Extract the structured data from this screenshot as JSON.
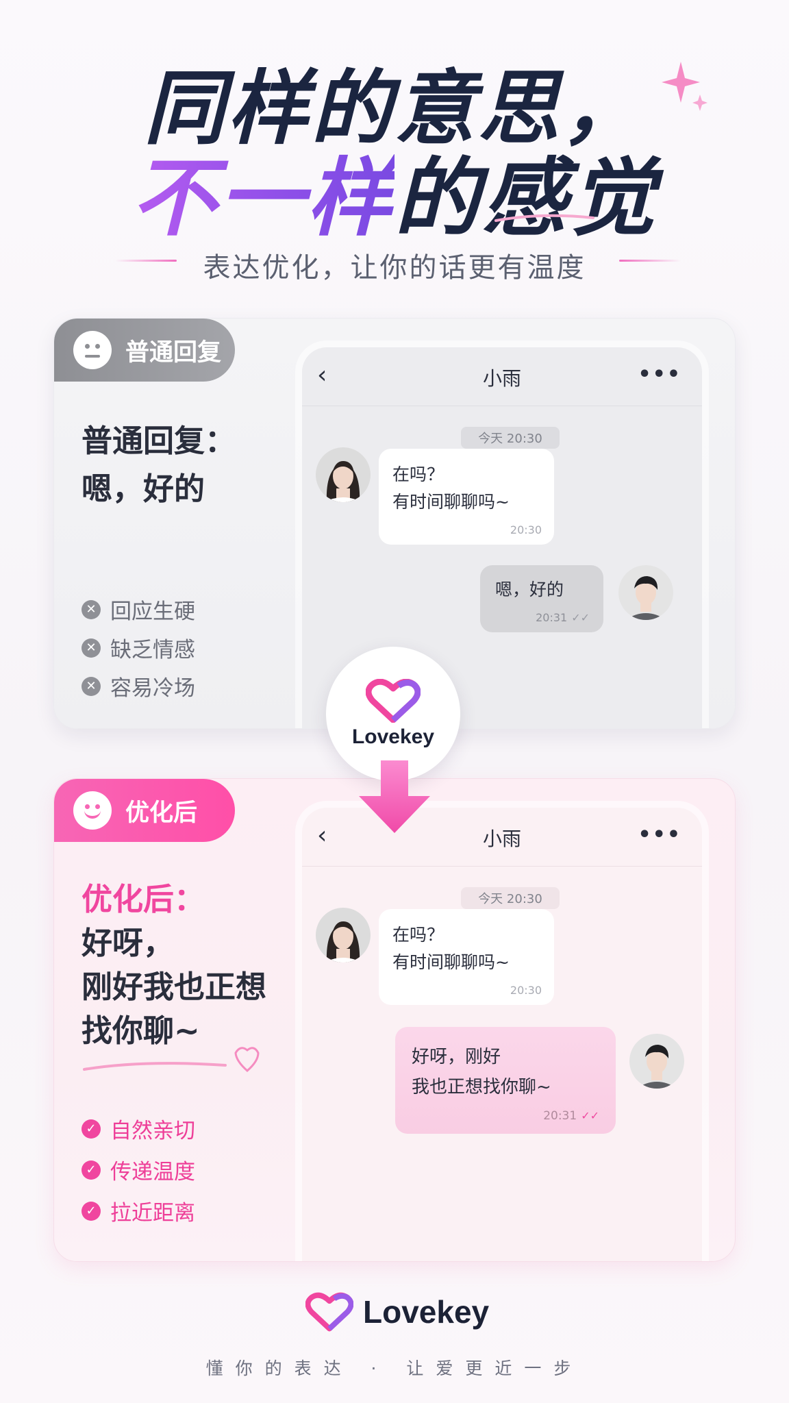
{
  "hero": {
    "line1": "同样的意思，",
    "line2_gradient": "不一样",
    "line2_dark": "的感觉",
    "subtitle": "表达优化，让你的话更有温度"
  },
  "normal": {
    "pill_label": "普通回复",
    "reply_title": "普通回复：",
    "reply_text": "嗯，好的",
    "points": [
      "回应生硬",
      "缺乏情感",
      "容易冷场"
    ]
  },
  "better": {
    "pill_label": "优化后",
    "head": "优化后：",
    "reply_text": "好呀，\n刚好我也正想\n找你聊~",
    "points": [
      "自然亲切",
      "传递温度",
      "拉近距离"
    ]
  },
  "phone": {
    "back_icon": "chevron-left",
    "contact_name": "小雨",
    "more_icon": "more",
    "time_tag": "今天 20:30",
    "incoming_text": "在吗？\n有时间聊聊吗~",
    "incoming_time": "20:30",
    "normal_outgoing_text": "嗯，好的",
    "normal_outgoing_time": "20:31",
    "better_outgoing_text": "好呀，刚好\n我也正想找你聊~",
    "better_outgoing_time": "20:31"
  },
  "badge": {
    "brand": "Lovekey"
  },
  "footer": {
    "brand": "Lovekey",
    "tagline": "懂你的表达 · 让爱更近一步"
  },
  "colors": {
    "accent_pink": "#f0469f",
    "accent_purple": "#8d4fe8",
    "navy": "#1b2540",
    "neutral_gray": "#8e8f94"
  }
}
